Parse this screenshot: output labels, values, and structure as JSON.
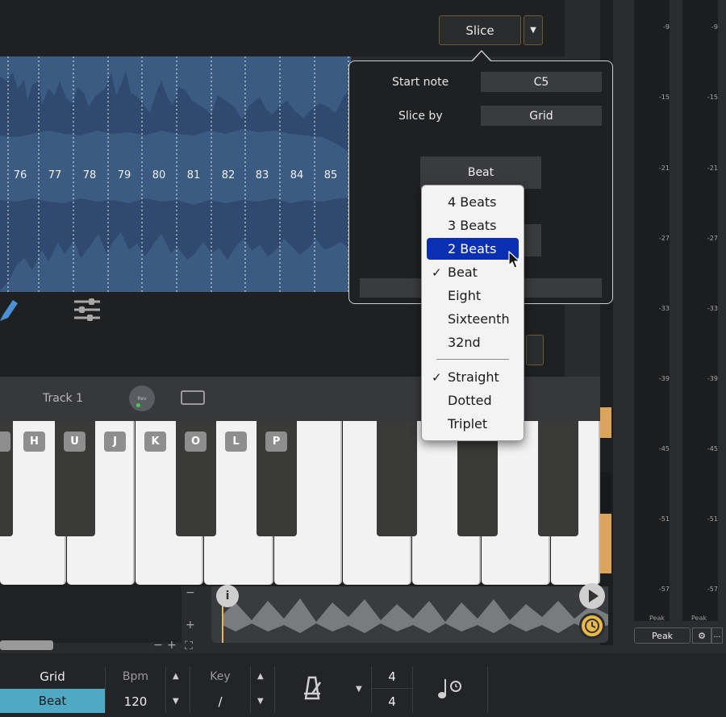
{
  "editor": {
    "slice_button": "Slice",
    "slice_numbers": [
      "76",
      "77",
      "78",
      "79",
      "80",
      "81",
      "82",
      "83",
      "84",
      "85"
    ]
  },
  "slice_settings": {
    "start_note_label": "Start note",
    "start_note_value": "C5",
    "slice_by_label": "Slice by",
    "slice_by_value": "Grid",
    "grid_button": "Beat"
  },
  "grid_menu": {
    "items": [
      {
        "label": "4 Beats",
        "checked": false,
        "selected": false
      },
      {
        "label": "3 Beats",
        "checked": false,
        "selected": false
      },
      {
        "label": "2 Beats",
        "checked": false,
        "selected": true
      },
      {
        "label": "Beat",
        "checked": true,
        "selected": false
      },
      {
        "label": "Eight",
        "checked": false,
        "selected": false
      },
      {
        "label": "Sixteenth",
        "checked": false,
        "selected": false
      },
      {
        "label": "32nd",
        "checked": false,
        "selected": false
      }
    ],
    "feel_items": [
      {
        "label": "Straight",
        "checked": true
      },
      {
        "label": "Dotted",
        "checked": false
      },
      {
        "label": "Triplet",
        "checked": false
      }
    ],
    "check_glyph": "✓"
  },
  "track": {
    "name": "Track 1",
    "rev_label": "Rev"
  },
  "keyboard_labels": [
    "H",
    "U",
    "J",
    "K",
    "O",
    "L",
    "P"
  ],
  "meters": {
    "db_labels": [
      "-9",
      "-15",
      "-21",
      "-27",
      "-33",
      "-39",
      "-45",
      "-51",
      "-57"
    ],
    "peak_label": "Peak",
    "peak_button": "Peak"
  },
  "toolbar": {
    "grid_label": "Grid",
    "grid_value": "Beat",
    "bpm_label": "Bpm",
    "bpm_value": "120",
    "key_label": "Key",
    "key_value": "/",
    "time_sig_top": "4",
    "time_sig_bottom": "4"
  },
  "mini": {
    "minus": "−",
    "plus": "+",
    "info": "i"
  },
  "colors": {
    "accent_blue": "#4fa8c4",
    "menu_selection": "#0a2fb0",
    "waveform": "#3c5b83",
    "clip_orange": "#d8a45e"
  }
}
